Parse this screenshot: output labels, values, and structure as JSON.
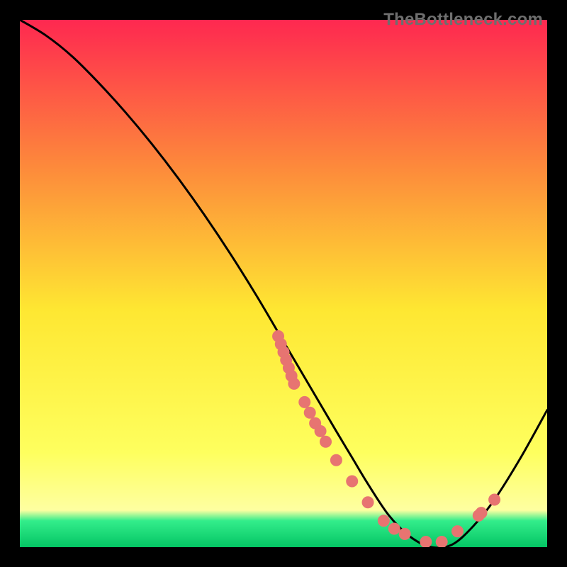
{
  "watermark": "TheBottleneck.com",
  "chart_data": {
    "type": "line",
    "title": "",
    "xlabel": "",
    "ylabel": "",
    "xlim": [
      0,
      100
    ],
    "ylim": [
      0,
      100
    ],
    "grid": false,
    "legend": false,
    "series": [
      {
        "name": "curve",
        "x": [
          0,
          5,
          10,
          15,
          20,
          25,
          30,
          35,
          40,
          45,
          50,
          55,
          60,
          63,
          66,
          70,
          74,
          78,
          82,
          86,
          90,
          95,
          100
        ],
        "y": [
          100,
          97,
          93,
          88,
          82.5,
          76.5,
          70,
          63,
          55.5,
          47.5,
          39,
          30.5,
          22,
          17,
          12,
          6,
          2,
          0,
          0.5,
          4,
          9,
          17,
          26
        ]
      }
    ],
    "scatter": {
      "name": "points",
      "x": [
        49,
        49.5,
        50,
        50.5,
        51,
        51.5,
        52,
        54,
        55,
        56,
        57,
        58,
        60,
        63,
        66,
        69,
        71,
        73,
        77,
        80,
        83,
        87,
        87.5,
        90
      ],
      "y": [
        40,
        38.5,
        37,
        35.5,
        34,
        32.5,
        31,
        27.5,
        25.5,
        23.5,
        22,
        20,
        16.5,
        12.5,
        8.5,
        5,
        3.5,
        2.5,
        1,
        1,
        3,
        6,
        6.5,
        9
      ]
    },
    "colors": {
      "curve": "#000000",
      "points_fill": "#e77471",
      "points_stroke": "#e77471",
      "gradient_top": "#fe2850",
      "gradient_mid_upper": "#fd8a3b",
      "gradient_mid": "#fee732",
      "gradient_mid_lower": "#feff5e",
      "gradient_band": "#33ed8b",
      "gradient_bottom": "#04c564"
    }
  }
}
